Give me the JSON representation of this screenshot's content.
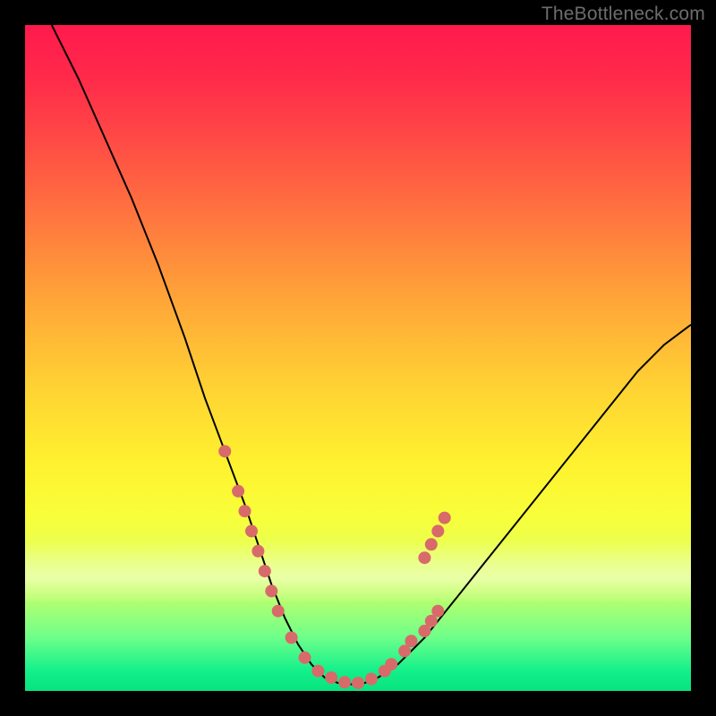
{
  "watermark": "TheBottleneck.com",
  "colors": {
    "frame": "#000000",
    "curve": "#000000",
    "dot": "#d86a6a",
    "gradient_top": "#ff1a4d",
    "gradient_mid": "#fff22f",
    "gradient_bottom": "#07e37f"
  },
  "chart_data": {
    "type": "line",
    "title": "",
    "xlabel": "",
    "ylabel": "",
    "xlim": [
      0,
      100
    ],
    "ylim": [
      0,
      100
    ],
    "grid": false,
    "legend": false,
    "description": "Asymmetric V-shaped bottleneck curve. Left branch drops steeply from top-left to a flat minimum near x≈40–50, right branch rises more gently, topping out near y≈55 at the right edge. Salmon dots mark sampled points clustered on the lower flanks and valley floor.",
    "series": [
      {
        "name": "bottleneck-curve",
        "x": [
          4,
          8,
          12,
          16,
          20,
          24,
          27,
          30,
          33,
          35,
          37,
          39,
          41,
          43,
          45,
          47,
          49,
          51,
          53,
          56,
          60,
          64,
          68,
          72,
          76,
          80,
          84,
          88,
          92,
          96,
          100
        ],
        "y": [
          100,
          92,
          83,
          74,
          64,
          53,
          44,
          36,
          28,
          22,
          16,
          11,
          7,
          4,
          2,
          1.2,
          1,
          1.2,
          2,
          4,
          8,
          13,
          18,
          23,
          28,
          33,
          38,
          43,
          48,
          52,
          55
        ]
      }
    ],
    "points": [
      {
        "name": "dot",
        "x": 30,
        "y": 36
      },
      {
        "name": "dot",
        "x": 32,
        "y": 30
      },
      {
        "name": "dot",
        "x": 33,
        "y": 27
      },
      {
        "name": "dot",
        "x": 34,
        "y": 24
      },
      {
        "name": "dot",
        "x": 35,
        "y": 21
      },
      {
        "name": "dot",
        "x": 36,
        "y": 18
      },
      {
        "name": "dot",
        "x": 37,
        "y": 15
      },
      {
        "name": "dot",
        "x": 38,
        "y": 12
      },
      {
        "name": "dot",
        "x": 40,
        "y": 8
      },
      {
        "name": "dot",
        "x": 42,
        "y": 5
      },
      {
        "name": "dot",
        "x": 44,
        "y": 3
      },
      {
        "name": "dot",
        "x": 46,
        "y": 2
      },
      {
        "name": "dot",
        "x": 48,
        "y": 1.3
      },
      {
        "name": "dot",
        "x": 50,
        "y": 1.2
      },
      {
        "name": "dot",
        "x": 52,
        "y": 1.8
      },
      {
        "name": "dot",
        "x": 54,
        "y": 3
      },
      {
        "name": "dot",
        "x": 55,
        "y": 4
      },
      {
        "name": "dot",
        "x": 57,
        "y": 6
      },
      {
        "name": "dot",
        "x": 58,
        "y": 7.5
      },
      {
        "name": "dot",
        "x": 60,
        "y": 9
      },
      {
        "name": "dot",
        "x": 61,
        "y": 10.5
      },
      {
        "name": "dot",
        "x": 62,
        "y": 12
      },
      {
        "name": "dot",
        "x": 60,
        "y": 20
      },
      {
        "name": "dot",
        "x": 61,
        "y": 22
      },
      {
        "name": "dot",
        "x": 62,
        "y": 24
      },
      {
        "name": "dot",
        "x": 63,
        "y": 26
      }
    ]
  }
}
